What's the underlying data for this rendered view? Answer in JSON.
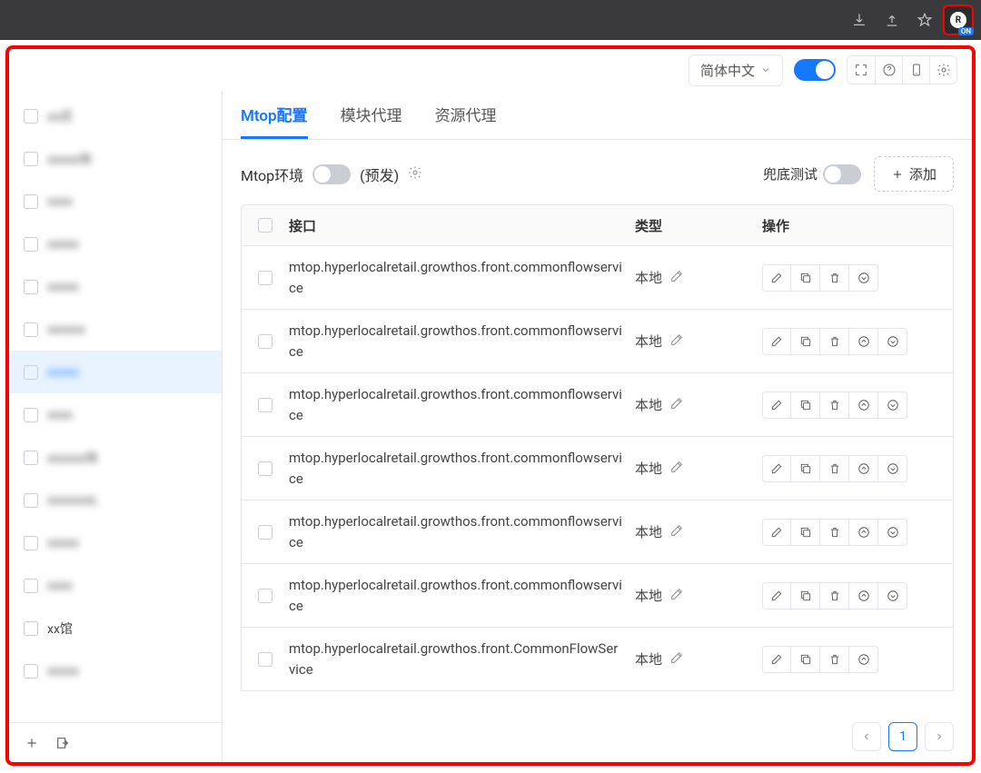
{
  "browser": {
    "ext_label": "R",
    "ext_status": "ON"
  },
  "header": {
    "language": "简体中文"
  },
  "sidebar": {
    "items": [
      {
        "label": "xx式",
        "blur": true
      },
      {
        "label": "xxxxx块",
        "blur": true
      },
      {
        "label": "xxxx",
        "blur": true
      },
      {
        "label": "xxxxx",
        "blur": true
      },
      {
        "label": "xxxxx",
        "blur": true
      },
      {
        "label": "xxxxxx",
        "blur": true
      },
      {
        "label": "xxxxx",
        "blur": true,
        "active": true
      },
      {
        "label": "xxxx",
        "blur": true
      },
      {
        "label": "xxxxxx块",
        "blur": true
      },
      {
        "label": "xxxxxxxL",
        "blur": true
      },
      {
        "label": "xxxxx",
        "blur": true
      },
      {
        "label": "xxxx",
        "blur": true
      },
      {
        "label": "xx馆",
        "blur": false
      },
      {
        "label": "xxxxx",
        "blur": true
      }
    ]
  },
  "tabs": [
    {
      "label": "Mtop配置",
      "active": true
    },
    {
      "label": "模块代理"
    },
    {
      "label": "资源代理"
    }
  ],
  "toolbar": {
    "env_label": "Mtop环境",
    "env_value": "(预发)",
    "fallback_label": "兜底测试",
    "add_label": "添加"
  },
  "table": {
    "headers": {
      "api": "接口",
      "type": "类型",
      "ops": "操作"
    },
    "rows": [
      {
        "api": "mtop.hyperlocalretail.growthos.front.commonflowservice",
        "type": "本地",
        "ops": [
          "edit",
          "copy",
          "delete",
          "down"
        ]
      },
      {
        "api": "mtop.hyperlocalretail.growthos.front.commonflowservice",
        "type": "本地",
        "ops": [
          "edit",
          "copy",
          "delete",
          "up",
          "down"
        ]
      },
      {
        "api": "mtop.hyperlocalretail.growthos.front.commonflowservice",
        "type": "本地",
        "ops": [
          "edit",
          "copy",
          "delete",
          "up",
          "down"
        ]
      },
      {
        "api": "mtop.hyperlocalretail.growthos.front.commonflowservice",
        "type": "本地",
        "ops": [
          "edit",
          "copy",
          "delete",
          "up",
          "down"
        ]
      },
      {
        "api": "mtop.hyperlocalretail.growthos.front.commonflowservice",
        "type": "本地",
        "ops": [
          "edit",
          "copy",
          "delete",
          "up",
          "down"
        ]
      },
      {
        "api": "mtop.hyperlocalretail.growthos.front.commonflowservice",
        "type": "本地",
        "ops": [
          "edit",
          "copy",
          "delete",
          "up",
          "down"
        ]
      },
      {
        "api": "mtop.hyperlocalretail.growthos.front.CommonFlowService",
        "type": "本地",
        "ops": [
          "edit",
          "copy",
          "delete",
          "up"
        ]
      }
    ]
  },
  "pagination": {
    "current": "1"
  }
}
